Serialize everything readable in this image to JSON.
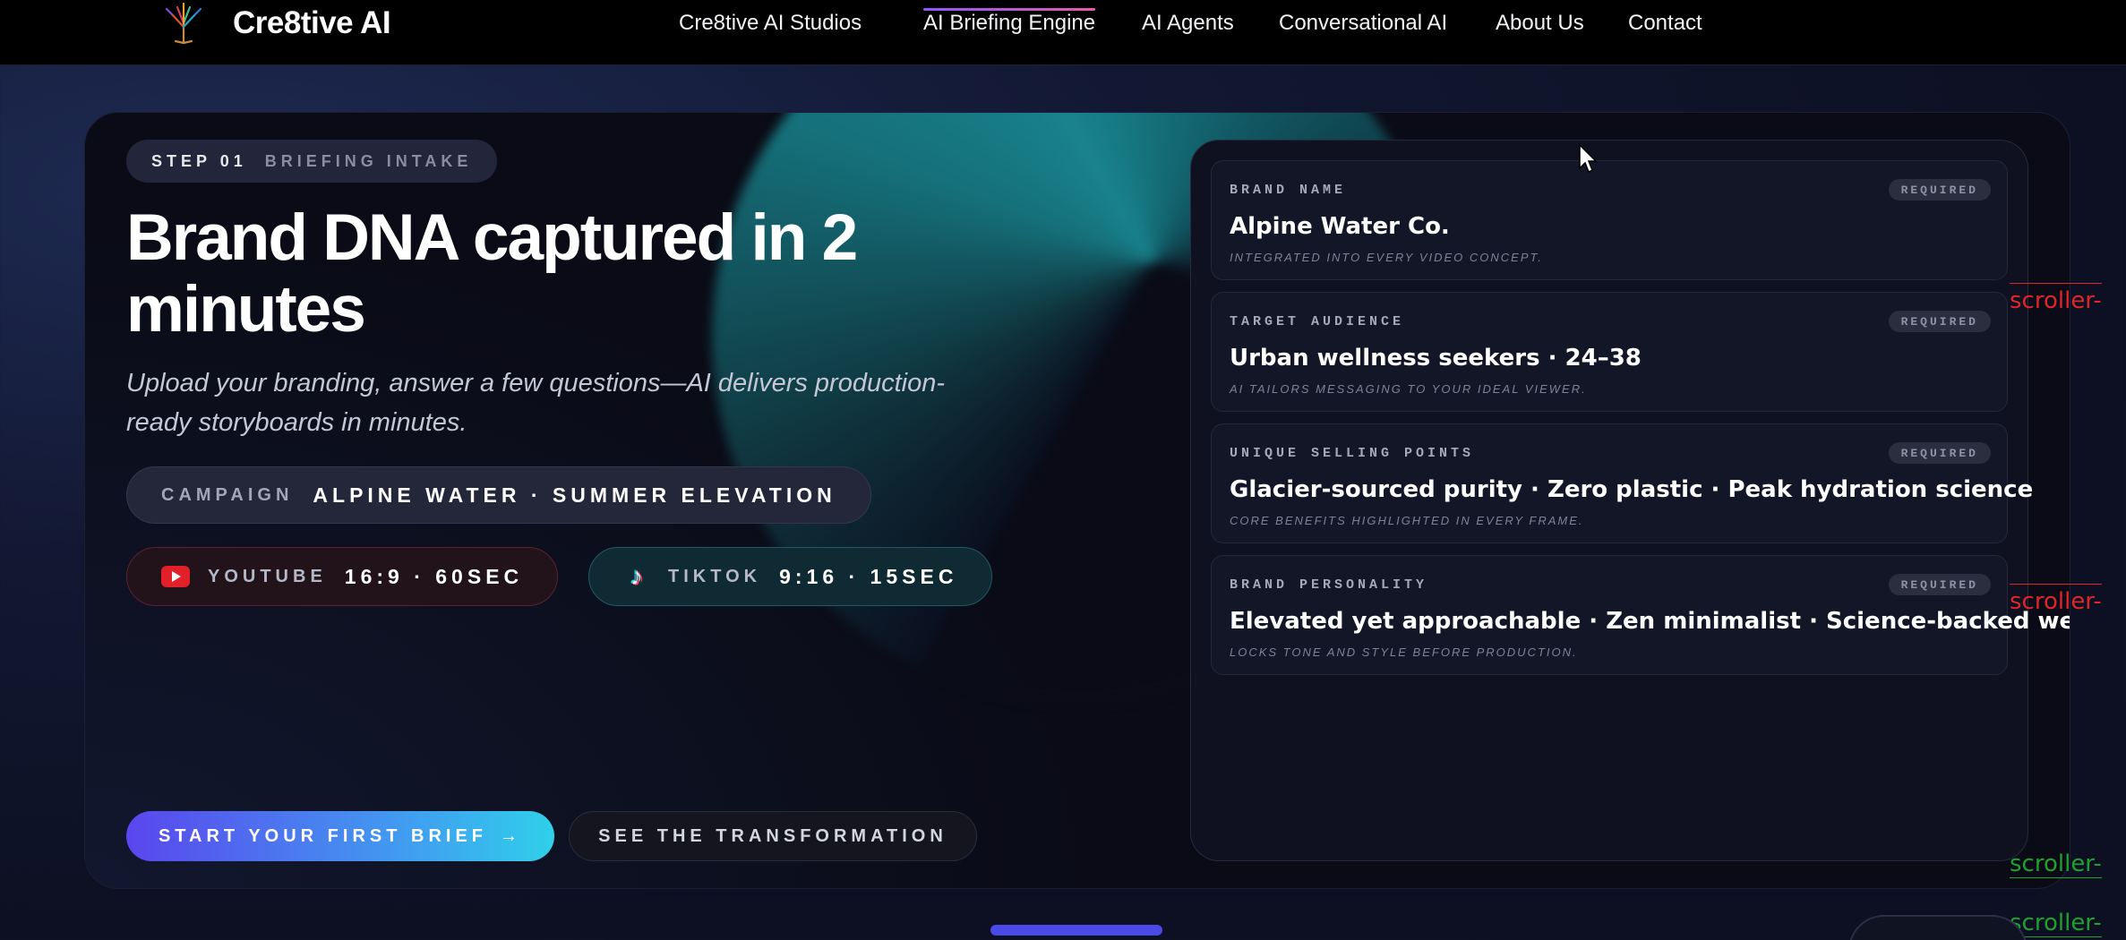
{
  "nav": {
    "brand": "Cre8tive AI",
    "items": [
      {
        "label": "Cre8tive AI Studios",
        "active": false
      },
      {
        "label": "AI Briefing Engine",
        "active": true
      },
      {
        "label": "AI Agents",
        "active": false
      },
      {
        "label": "Conversational AI",
        "active": false
      },
      {
        "label": "About Us",
        "active": false
      },
      {
        "label": "Contact",
        "active": false
      }
    ]
  },
  "hero": {
    "step_number": "STEP 01",
    "step_label": "BRIEFING INTAKE",
    "headline": "Brand DNA captured in 2 minutes",
    "subtitle": "Upload your branding, answer a few questions—AI delivers production-ready storyboards in minutes.",
    "campaign_label": "CAMPAIGN",
    "campaign_value": "ALPINE WATER · SUMMER ELEVATION",
    "platforms": [
      {
        "icon": "youtube-icon",
        "label": "YOUTUBE",
        "value": "16:9 · 60SEC"
      },
      {
        "icon": "tiktok-icon",
        "label": "TIKTOK",
        "value": "9:16 · 15SEC"
      }
    ],
    "primary_cta": "START YOUR FIRST BRIEF",
    "primary_cta_icon": "→",
    "secondary_cta": "SEE THE TRANSFORMATION"
  },
  "form": {
    "fields": [
      {
        "label": "BRAND NAME",
        "badge": "REQUIRED",
        "value": "Alpine Water Co.",
        "hint": "INTEGRATED INTO EVERY VIDEO CONCEPT."
      },
      {
        "label": "TARGET AUDIENCE",
        "badge": "REQUIRED",
        "value": "Urban wellness seekers · 24–38",
        "hint": "AI TAILORS MESSAGING TO YOUR IDEAL VIEWER."
      },
      {
        "label": "UNIQUE SELLING POINTS",
        "badge": "REQUIRED",
        "value": "Glacier-sourced purity · Zero plastic · Peak hydration science",
        "hint": "CORE BENEFITS HIGHLIGHTED IN EVERY FRAME."
      },
      {
        "label": "BRAND PERSONALITY",
        "badge": "REQUIRED",
        "value": "Elevated yet approachable · Zen minimalist · Science-backed wellness",
        "hint": "LOCKS TONE AND STYLE BEFORE PRODUCTION."
      }
    ]
  },
  "debug": {
    "scroller_markers": [
      "scroller-",
      "scroller-",
      "scroller-",
      "scroller-"
    ]
  },
  "colors": {
    "accent_gradient_start": "#5a46ee",
    "accent_gradient_end": "#2fd0ea",
    "nav_active_underline": "#8f55ff",
    "scroller_start": "#e0242c",
    "scroller_end": "#1ea12d"
  }
}
